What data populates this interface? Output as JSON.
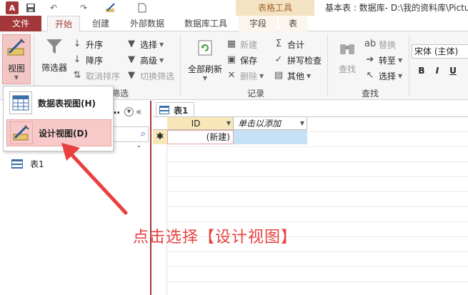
{
  "titlebar": {
    "app_icon_label": "A",
    "undo_glyph": "↶",
    "redo_glyph": "↷",
    "tool_group": "表格工具",
    "window_title": "基本表 : 数据库- D:\\我的资料库\\Pictu"
  },
  "tabs": {
    "file": "文件",
    "home": "开始",
    "create": "创建",
    "external": "外部数据",
    "dbtools": "数据库工具",
    "fields": "字段",
    "table": "表"
  },
  "ribbon": {
    "view": "视图",
    "filter": "筛选器",
    "sort_asc": "升序",
    "sort_desc": "降序",
    "clear_sort": "取消排序",
    "selection": "选择",
    "advanced": "高级",
    "toggle_filter": "切换筛选",
    "sort_filter_group": "筛选",
    "refresh_all": "全部刷新",
    "new": "新建",
    "save": "保存",
    "delete": "删除",
    "totals": "合计",
    "spelling": "拼写检查",
    "more": "其他",
    "records_group": "记录",
    "find": "查找",
    "replace": "替换",
    "goto": "转至",
    "select": "选择",
    "find_group": "查找",
    "font_name": "宋体 (主体)",
    "bold": "B",
    "italic": "I",
    "underline": "U"
  },
  "view_menu": {
    "datasheet": "数据表视图(H)",
    "design": "设计视图(D)"
  },
  "nav": {
    "header_dots": "…",
    "collapse": "«",
    "group_collapse": "⌃",
    "table_item": "表1"
  },
  "document": {
    "tab_label": "表1",
    "columns": [
      "ID",
      "单击以添加"
    ],
    "new_row_marker": "✱",
    "new_row_value": "(新建)"
  },
  "annotation": {
    "text": "点击选择【设计视图】",
    "color": "#e8413f"
  },
  "colors": {
    "accent": "#a4373a",
    "highlight": "#f7c9c9",
    "header_bg": "#f8e8b8",
    "tool_tab": "#f3e3c3"
  }
}
